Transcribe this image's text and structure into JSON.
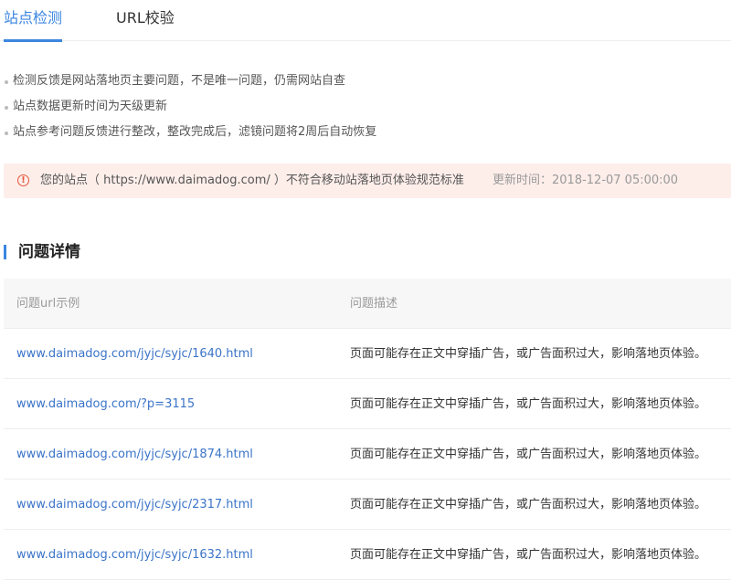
{
  "tabs": [
    {
      "label": "站点检测",
      "active": true
    },
    {
      "label": "URL校验",
      "active": false
    }
  ],
  "notes": [
    "检测反馈是网站落地页主要问题，不是唯一问题，仍需网站自查",
    "站点数据更新时间为天级更新",
    "站点参考问题反馈进行整改，整改完成后，滤镜问题将2周后自动恢复"
  ],
  "alert": {
    "icon": "!",
    "message": "您的站点（ https://www.daimadog.com/ ）不符合移动站落地页体验规范标准",
    "update_time": "更新时间：2018-12-07 05:00:00"
  },
  "section": {
    "title": "问题详情"
  },
  "table": {
    "headers": {
      "url": "问题url示例",
      "desc": "问题描述"
    },
    "rows": [
      {
        "url": "www.daimadog.com/jyjc/syjc/1640.html",
        "desc": "页面可能存在正文中穿插广告，或广告面积过大，影响落地页体验。"
      },
      {
        "url": "www.daimadog.com/?p=3115",
        "desc": "页面可能存在正文中穿插广告，或广告面积过大，影响落地页体验。"
      },
      {
        "url": "www.daimadog.com/jyjc/syjc/1874.html",
        "desc": "页面可能存在正文中穿插广告，或广告面积过大，影响落地页体验。"
      },
      {
        "url": "www.daimadog.com/jyjc/syjc/2317.html",
        "desc": "页面可能存在正文中穿插广告，或广告面积过大，影响落地页体验。"
      },
      {
        "url": "www.daimadog.com/jyjc/syjc/1632.html",
        "desc": "页面可能存在正文中穿插广告，或广告面积过大，影响落地页体验。"
      }
    ]
  },
  "colors": {
    "accent": "#3b86e0",
    "link": "#3b74c8",
    "alert_bg": "#fdeeea",
    "alert_icon": "#e6553b"
  }
}
